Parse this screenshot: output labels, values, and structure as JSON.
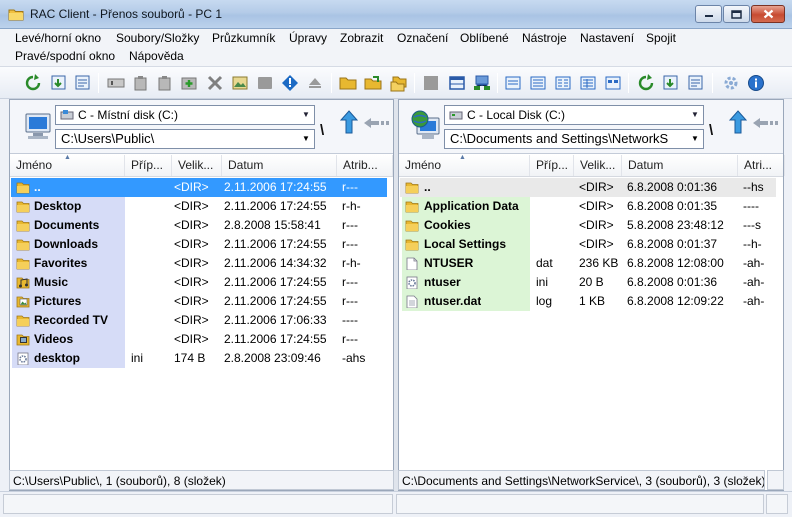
{
  "window": {
    "title": "RAC Client - Přenos souborů - PC 1"
  },
  "menu": [
    "Levé/horní okno",
    "Soubory/Složky",
    "Průzkumník",
    "Úpravy",
    "Zobrazit",
    "Označení",
    "Oblíbené",
    "Nástroje",
    "Nastavení",
    "Spojit",
    "Pravé/spodní okno",
    "Nápověda"
  ],
  "toolbar": {
    "icons": [
      "refresh-icon",
      "download-icon",
      "list-icon",
      "rename-icon",
      "copy-icon",
      "paste-icon",
      "new-folder-icon",
      "delete-icon",
      "image-icon",
      "stop-icon",
      "info-icon",
      "eject-icon",
      "open-folder-icon",
      "send-icon",
      "move-icon",
      "square-icon",
      "window-icon",
      "network-icon",
      "view-large-icon",
      "view-small-icon",
      "view-list-icon",
      "view-details-icon",
      "view-thumb-icon",
      "refresh-right-icon",
      "download-right-icon",
      "list-right-icon",
      "settings-icon",
      "about-icon"
    ]
  },
  "left_pane": {
    "drive": "C - Místní disk (C:)",
    "path": "C:\\Users\\Public\\",
    "columns": [
      "Jméno",
      "Příp...",
      "Velik...",
      "Datum",
      "Atrib..."
    ],
    "rows": [
      {
        "name": "..",
        "ext": "",
        "size": "<DIR>",
        "date": "2.11.2006 17:24:55",
        "attr": "r---",
        "icon": "folder-up-icon"
      },
      {
        "name": "Desktop",
        "ext": "",
        "size": "<DIR>",
        "date": "2.11.2006 17:24:55",
        "attr": "r-h-",
        "icon": "folder-icon"
      },
      {
        "name": "Documents",
        "ext": "",
        "size": "<DIR>",
        "date": "2.8.2008 15:58:41",
        "attr": "r---",
        "icon": "folder-icon"
      },
      {
        "name": "Downloads",
        "ext": "",
        "size": "<DIR>",
        "date": "2.11.2006 17:24:55",
        "attr": "r---",
        "icon": "folder-icon"
      },
      {
        "name": "Favorites",
        "ext": "",
        "size": "<DIR>",
        "date": "2.11.2006 14:34:32",
        "attr": "r-h-",
        "icon": "folder-icon"
      },
      {
        "name": "Music",
        "ext": "",
        "size": "<DIR>",
        "date": "2.11.2006 17:24:55",
        "attr": "r---",
        "icon": "music-folder-icon"
      },
      {
        "name": "Pictures",
        "ext": "",
        "size": "<DIR>",
        "date": "2.11.2006 17:24:55",
        "attr": "r---",
        "icon": "pictures-folder-icon"
      },
      {
        "name": "Recorded TV",
        "ext": "",
        "size": "<DIR>",
        "date": "2.11.2006 17:06:33",
        "attr": "----",
        "icon": "folder-icon"
      },
      {
        "name": "Videos",
        "ext": "",
        "size": "<DIR>",
        "date": "2.11.2006 17:24:55",
        "attr": "r---",
        "icon": "video-folder-icon"
      },
      {
        "name": "desktop",
        "ext": "ini",
        "size": "174 B",
        "date": "2.8.2008 23:09:46",
        "attr": "-ahs",
        "icon": "settings-file-icon"
      }
    ],
    "status": "C:\\Users\\Public\\, 1 (souborů), 8 (složek)"
  },
  "right_pane": {
    "drive": "C - Local Disk (C:)",
    "path": "C:\\Documents and Settings\\NetworkS",
    "columns": [
      "Jméno",
      "Příp...",
      "Velik...",
      "Datum",
      "Atri..."
    ],
    "rows": [
      {
        "name": "..",
        "ext": "",
        "size": "<DIR>",
        "date": "6.8.2008 0:01:36",
        "attr": "--hs",
        "icon": "folder-up-icon"
      },
      {
        "name": "Application Data",
        "ext": "",
        "size": "<DIR>",
        "date": "6.8.2008 0:01:35",
        "attr": "----",
        "icon": "folder-icon"
      },
      {
        "name": "Cookies",
        "ext": "",
        "size": "<DIR>",
        "date": "5.8.2008 23:48:12",
        "attr": "---s",
        "icon": "folder-icon"
      },
      {
        "name": "Local Settings",
        "ext": "",
        "size": "<DIR>",
        "date": "6.8.2008 0:01:37",
        "attr": "--h-",
        "icon": "folder-icon"
      },
      {
        "name": "NTUSER",
        "ext": "dat",
        "size": "236 KB",
        "date": "6.8.2008 12:08:00",
        "attr": "-ah-",
        "icon": "file-icon"
      },
      {
        "name": "ntuser",
        "ext": "ini",
        "size": "20 B",
        "date": "6.8.2008 0:01:36",
        "attr": "-ah-",
        "icon": "settings-file-icon"
      },
      {
        "name": "ntuser.dat",
        "ext": "log",
        "size": "1 KB",
        "date": "6.8.2008 12:09:22",
        "attr": "-ah-",
        "icon": "text-file-icon"
      }
    ],
    "status": "C:\\Documents and Settings\\NetworkService\\, 3 (souborů), 3 (složek)"
  },
  "colors": {
    "left_highlight": "#d6dcf7",
    "right_highlight": "#dcf5d6",
    "selection": "#3399ff",
    "folder": "#e8b830"
  }
}
